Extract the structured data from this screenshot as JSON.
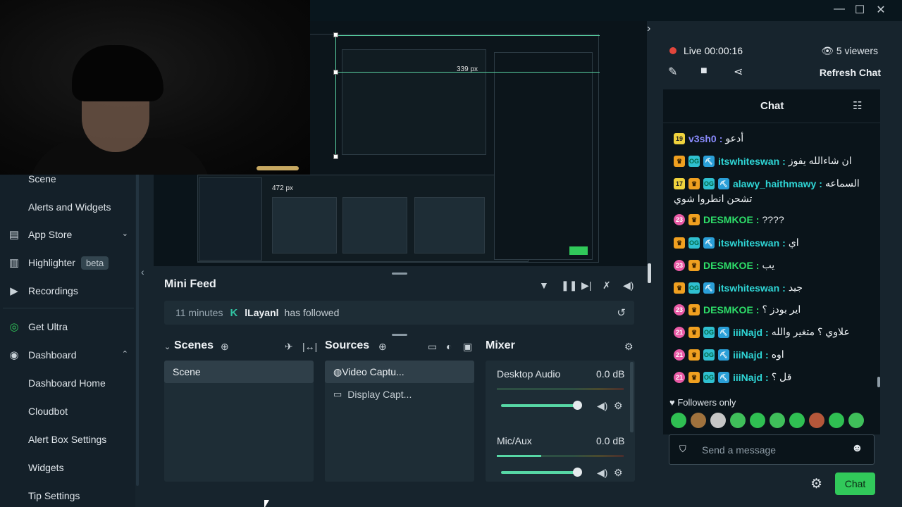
{
  "window": {
    "minimize": "—",
    "maximize": "☐",
    "close": "✕"
  },
  "sidebar": {
    "items": [
      {
        "label": "Scene",
        "icon": "",
        "sub": true
      },
      {
        "label": "Alerts and Widgets",
        "icon": "",
        "sub": true
      },
      {
        "label": "App Store",
        "icon": "store-icon"
      },
      {
        "label": "Highlighter",
        "icon": "highlighter-icon",
        "badge": "beta"
      },
      {
        "label": "Recordings",
        "icon": "play-icon"
      },
      {
        "label": "Get Ultra",
        "icon": "ultra-icon"
      },
      {
        "label": "Dashboard",
        "icon": "dashboard-icon"
      },
      {
        "label": "Dashboard Home",
        "sub": true
      },
      {
        "label": "Cloudbot",
        "sub": true
      },
      {
        "label": "Alert Box Settings",
        "sub": true
      },
      {
        "label": "Widgets",
        "sub": true
      },
      {
        "label": "Tip Settings",
        "sub": true
      }
    ]
  },
  "preview": {
    "measure_label": "339 px",
    "measure_label_2": "472 px"
  },
  "minifeed": {
    "title": "Mini Feed",
    "event": {
      "time": "11 minutes",
      "name": "lLayanl",
      "action": "has followed"
    }
  },
  "scenes": {
    "title": "Scenes",
    "items": [
      "Scene"
    ]
  },
  "sources": {
    "title": "Sources",
    "items": [
      "Video Captu...",
      "Display Capt..."
    ]
  },
  "mixer": {
    "title": "Mixer",
    "channels": [
      {
        "name": "Desktop Audio",
        "db": "0.0 dB",
        "level": 0.0
      },
      {
        "name": "Mic/Aux",
        "db": "0.0 dB",
        "level": 0.35
      }
    ]
  },
  "chat": {
    "live_label": "Live",
    "timer": "00:00:16",
    "viewers": "5 viewers",
    "refresh": "Refresh Chat",
    "title": "Chat",
    "messages": [
      {
        "badges": [
          "sub"
        ],
        "sub_num": "19",
        "user": "v3sh0",
        "color": "#8b8cff",
        "text": "أدعو"
      },
      {
        "badges": [
          "crown",
          "ez",
          "pick"
        ],
        "user": "itswhiteswan",
        "color": "#2fd6d6",
        "text": "ان شاءالله يفوز"
      },
      {
        "badges": [
          "sub",
          "crown",
          "ez",
          "pick"
        ],
        "sub_num": "17",
        "user": "alawy_haithmawy",
        "color": "#2fd6d6",
        "text": "السماعه",
        "text2": "تشحن انطروا شوي"
      },
      {
        "badges": [
          "lvl",
          "crown"
        ],
        "lvl_num": "23",
        "user": "DESMKOE",
        "color": "#2ee06a",
        "text": "????"
      },
      {
        "badges": [
          "crown",
          "ez",
          "pick"
        ],
        "user": "itswhiteswan",
        "color": "#2fd6d6",
        "text": "اي"
      },
      {
        "badges": [
          "lvl",
          "crown"
        ],
        "lvl_num": "23",
        "user": "DESMKOE",
        "color": "#2ee06a",
        "text": "يب"
      },
      {
        "badges": [
          "crown",
          "ez",
          "pick"
        ],
        "user": "itswhiteswan",
        "color": "#2fd6d6",
        "text": "جيد"
      },
      {
        "badges": [
          "lvl",
          "crown"
        ],
        "lvl_num": "23",
        "user": "DESMKOE",
        "color": "#2ee06a",
        "text": "اير بودز ؟"
      },
      {
        "badges": [
          "lvl",
          "crown",
          "ez",
          "pick"
        ],
        "lvl_num": "21",
        "user": "iiiNajd",
        "color": "#2fd6d6",
        "text": "علاوي ؟ متغير والله"
      },
      {
        "badges": [
          "lvl",
          "crown",
          "ez",
          "pick"
        ],
        "lvl_num": "21",
        "user": "iiiNajd",
        "color": "#2fd6d6",
        "text": "اوه"
      },
      {
        "badges": [
          "lvl",
          "crown",
          "ez",
          "pick"
        ],
        "lvl_num": "21",
        "user": "iiiNajd",
        "color": "#2fd6d6",
        "text": "قل ؟"
      }
    ],
    "followers_only": "Followers only",
    "input_placeholder": "Send a message",
    "send_label": "Chat"
  },
  "colors": {
    "accent": "#31c95a",
    "live": "#e2463c",
    "teal": "#57d7a5"
  }
}
